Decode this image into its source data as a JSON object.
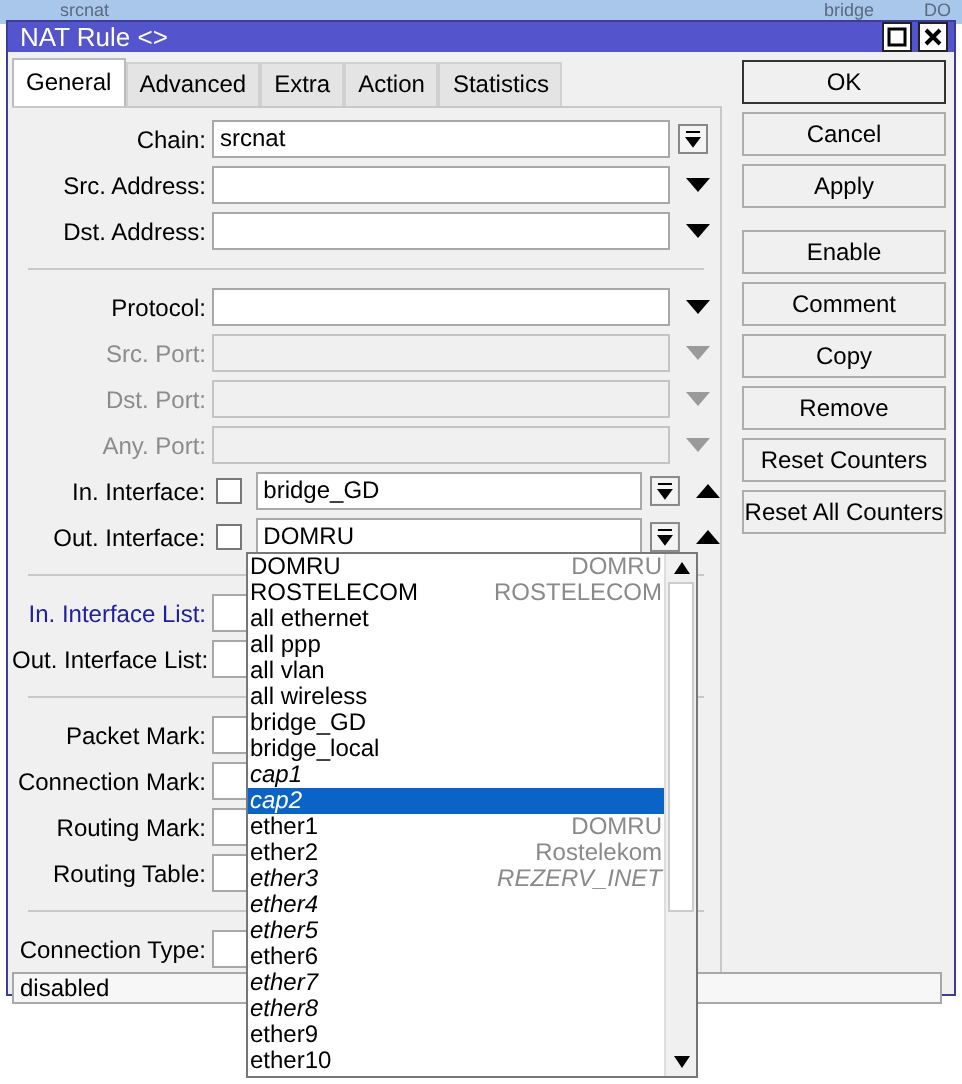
{
  "background_table": {
    "cells": [
      "srcnat",
      "bridge",
      "DO"
    ]
  },
  "window": {
    "title": "NAT Rule <>"
  },
  "tabs": [
    {
      "label": "General",
      "selected": true
    },
    {
      "label": "Advanced",
      "selected": false
    },
    {
      "label": "Extra",
      "selected": false
    },
    {
      "label": "Action",
      "selected": false
    },
    {
      "label": "Statistics",
      "selected": false
    }
  ],
  "fields": [
    {
      "kind": "combo",
      "label": "Chain:",
      "value": "srcnat",
      "disabled": false
    },
    {
      "kind": "select",
      "label": "Src. Address:",
      "disabled": false
    },
    {
      "kind": "select",
      "label": "Dst. Address:",
      "disabled": false
    },
    {
      "kind": "separator"
    },
    {
      "kind": "select",
      "label": "Protocol:",
      "disabled": false
    },
    {
      "kind": "select",
      "label": "Src. Port:",
      "disabled": true
    },
    {
      "kind": "select",
      "label": "Dst. Port:",
      "disabled": true
    },
    {
      "kind": "select",
      "label": "Any. Port:",
      "disabled": true
    },
    {
      "kind": "interface",
      "label": "In. Interface:",
      "value": "bridge_GD",
      "checked": false
    },
    {
      "kind": "interface",
      "label": "Out. Interface:",
      "value": "DOMRU",
      "checked": false
    },
    {
      "kind": "separator"
    },
    {
      "kind": "covered",
      "label": "In. Interface List:",
      "highlighted": true
    },
    {
      "kind": "covered",
      "label": "Out. Interface List:",
      "highlighted": false
    },
    {
      "kind": "separator"
    },
    {
      "kind": "covered",
      "label": "Packet Mark:",
      "highlighted": false
    },
    {
      "kind": "covered",
      "label": "Connection Mark:",
      "highlighted": false
    },
    {
      "kind": "covered",
      "label": "Routing Mark:",
      "highlighted": false
    },
    {
      "kind": "covered",
      "label": "Routing Table:",
      "highlighted": false
    },
    {
      "kind": "separator"
    },
    {
      "kind": "covered",
      "label": "Connection Type:",
      "highlighted": false
    }
  ],
  "buttons": [
    {
      "label": "OK",
      "default": true
    },
    {
      "label": "Cancel",
      "default": false
    },
    {
      "label": "Apply",
      "default": false
    },
    {
      "label": "Enable",
      "default": false
    },
    {
      "label": "Comment",
      "default": false
    },
    {
      "label": "Copy",
      "default": false
    },
    {
      "label": "Remove",
      "default": false
    },
    {
      "label": "Reset Counters",
      "default": false
    },
    {
      "label": "Reset All Counters",
      "default": false
    }
  ],
  "status_bar": {
    "text": "disabled"
  },
  "dropdown": {
    "items": [
      {
        "name": "DOMRU",
        "comment": "DOMRU",
        "inactive": false,
        "selected": false
      },
      {
        "name": "ROSTELECOM",
        "comment": "ROSTELECOM",
        "inactive": false,
        "selected": false
      },
      {
        "name": "all ethernet",
        "inactive": false,
        "selected": false
      },
      {
        "name": "all ppp",
        "inactive": false,
        "selected": false
      },
      {
        "name": "all vlan",
        "inactive": false,
        "selected": false
      },
      {
        "name": "all wireless",
        "inactive": false,
        "selected": false
      },
      {
        "name": "bridge_GD",
        "inactive": false,
        "selected": false
      },
      {
        "name": "bridge_local",
        "inactive": false,
        "selected": false
      },
      {
        "name": "cap1",
        "inactive": true,
        "selected": false
      },
      {
        "name": "cap2",
        "inactive": true,
        "selected": true
      },
      {
        "name": "ether1",
        "comment": "DOMRU",
        "inactive": false,
        "selected": false
      },
      {
        "name": "ether2",
        "comment": "Rostelekom",
        "inactive": false,
        "selected": false
      },
      {
        "name": "ether3",
        "comment": "REZERV_INET",
        "inactive": true,
        "selected": false
      },
      {
        "name": "ether4",
        "inactive": true,
        "selected": false
      },
      {
        "name": "ether5",
        "inactive": true,
        "selected": false
      },
      {
        "name": "ether6",
        "inactive": false,
        "selected": false
      },
      {
        "name": "ether7",
        "inactive": true,
        "selected": false
      },
      {
        "name": "ether8",
        "inactive": true,
        "selected": false
      },
      {
        "name": "ether9",
        "inactive": false,
        "selected": false
      },
      {
        "name": "ether10",
        "inactive": false,
        "selected": false
      }
    ]
  }
}
